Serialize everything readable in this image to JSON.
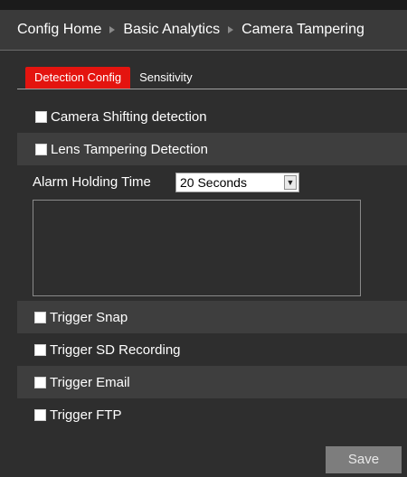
{
  "breadcrumb": [
    "Config Home",
    "Basic Analytics",
    "Camera Tampering"
  ],
  "tabs": [
    {
      "label": "Detection Config",
      "active": true
    },
    {
      "label": "Sensitivity",
      "active": false
    }
  ],
  "detection": {
    "camera_shifting": {
      "label": "Camera Shifting detection",
      "checked": false
    },
    "lens_tampering": {
      "label": "Lens Tampering Detection",
      "checked": false
    }
  },
  "alarm_holding": {
    "label": "Alarm Holding Time",
    "value": "20 Seconds"
  },
  "triggers": {
    "snap": {
      "label": "Trigger Snap",
      "checked": false
    },
    "sd_recording": {
      "label": "Trigger SD Recording",
      "checked": false
    },
    "email": {
      "label": "Trigger Email",
      "checked": false
    },
    "ftp": {
      "label": "Trigger FTP",
      "checked": false
    }
  },
  "save_label": "Save",
  "colors": {
    "accent": "#e4140f",
    "background": "#2e2e2e"
  }
}
